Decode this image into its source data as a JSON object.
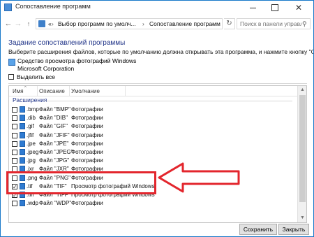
{
  "window": {
    "title": "Сопоставление программ",
    "controls": {
      "minimize": "minimize",
      "maximize": "maximize",
      "close": "✕"
    }
  },
  "nav": {
    "back": "←",
    "forward": "→",
    "up": "↑",
    "crumb_root": "«",
    "breadcrumbs": [
      "Выбор программ по умолч...",
      "Сопоставление программ"
    ],
    "separator": "›",
    "dropdown": "⌄",
    "refresh": "↻",
    "search_placeholder": "Поиск в панели управления",
    "search_icon": "⚲"
  },
  "main": {
    "heading": "Задание сопоставлений программы",
    "instructions": "Выберите расширения файлов, которые по умолчанию должна открывать эта программа, и нажмите кнопку \"Сохранить\".",
    "program_name": "Средство просмотра фотографий Windows",
    "program_company": "Microsoft Corporation",
    "select_all": "Выделить все",
    "select_all_checked": false
  },
  "list": {
    "columns": [
      "Имя",
      "Описание",
      "Умолчание"
    ],
    "sort_icon": "^",
    "group": "Расширения",
    "rows": [
      {
        "ext": ".bmp",
        "desc": "Файл \"BMP\"",
        "default": "Фотографии",
        "checked": false
      },
      {
        "ext": ".dib",
        "desc": "Файл \"DIB\"",
        "default": "Фотографии",
        "checked": false
      },
      {
        "ext": ".gif",
        "desc": "Файл \"GIF\"",
        "default": "Фотографии",
        "checked": false
      },
      {
        "ext": ".jfif",
        "desc": "Файл \"JFIF\"",
        "default": "Фотографии",
        "checked": false
      },
      {
        "ext": ".jpe",
        "desc": "Файл \"JPE\"",
        "default": "Фотографии",
        "checked": false
      },
      {
        "ext": ".jpeg",
        "desc": "Файл \"JPEG\"",
        "default": "Фотографии",
        "checked": false
      },
      {
        "ext": ".jpg",
        "desc": "Файл \"JPG\"",
        "default": "Фотографии",
        "checked": false
      },
      {
        "ext": ".jxr",
        "desc": "Файл \"JXR\"",
        "default": "Фотографии",
        "checked": false
      },
      {
        "ext": ".png",
        "desc": "Файл \"PNG\"",
        "default": "Фотографии",
        "checked": false
      },
      {
        "ext": ".tif",
        "desc": "Файл \"TIF\"",
        "default": "Просмотр фотографий Windows",
        "checked": true
      },
      {
        "ext": ".tiff",
        "desc": "Файл \"TIFF\"",
        "default": "Просмотр фотографий Windows",
        "checked": true
      },
      {
        "ext": ".wdp",
        "desc": "Файл \"WDP\"",
        "default": "Фотографии",
        "checked": false
      }
    ],
    "scroll_up": "▲",
    "scroll_down": "▼"
  },
  "annotation": {
    "color": "#e3262d"
  },
  "buttons": {
    "save": "Сохранить",
    "close": "Закрыть"
  },
  "colors": {
    "accent": "#1979ca",
    "heading": "#1e3287"
  }
}
